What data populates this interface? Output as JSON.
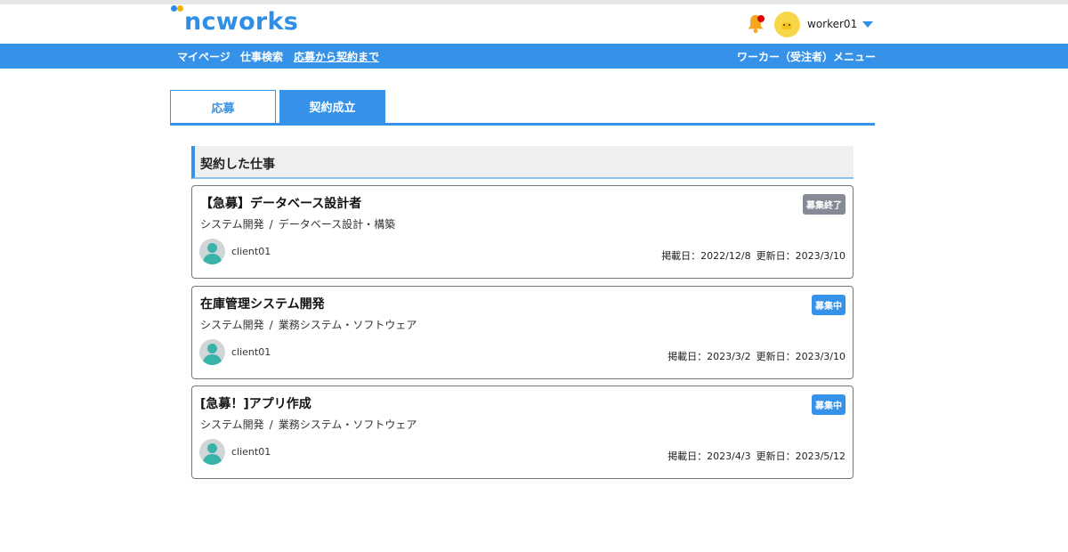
{
  "header": {
    "logo_text": "ncworks",
    "username": "worker01",
    "has_notification": true
  },
  "nav": {
    "items": [
      {
        "label": "マイページ"
      },
      {
        "label": "仕事検索"
      },
      {
        "label": "応募から契約まで"
      }
    ],
    "right_menu": "ワーカー（受注者）メニュー"
  },
  "tabs": [
    {
      "label": "応募",
      "active": false
    },
    {
      "label": "契約成立",
      "active": true
    }
  ],
  "section": {
    "title": "契約した仕事"
  },
  "jobs": [
    {
      "title": "【急募】データベース設計者",
      "category": "システム開発",
      "subcategory": "データベース設計・構築",
      "status": "募集終了",
      "client": "client01",
      "posted": "掲載日：2022/12/8",
      "updated": "更新日：2023/3/10"
    },
    {
      "title": "在庫管理システム開発",
      "category": "システム開発",
      "subcategory": "業務システム・ソフトウェア",
      "status": "募集中",
      "client": "client01",
      "posted": "掲載日：2023/3/2",
      "updated": "更新日：2023/3/10"
    },
    {
      "title": "[急募！]アプリ作成",
      "category": "システム開発",
      "subcategory": "業務システム・ソフトウェア",
      "status": "募集中",
      "client": "client01",
      "posted": "掲載日：2023/4/3",
      "updated": "更新日：2023/5/12"
    }
  ],
  "colors": {
    "brand": "#3592e8",
    "badge_ended": "#858a96",
    "notification_dot": "#e00000"
  }
}
